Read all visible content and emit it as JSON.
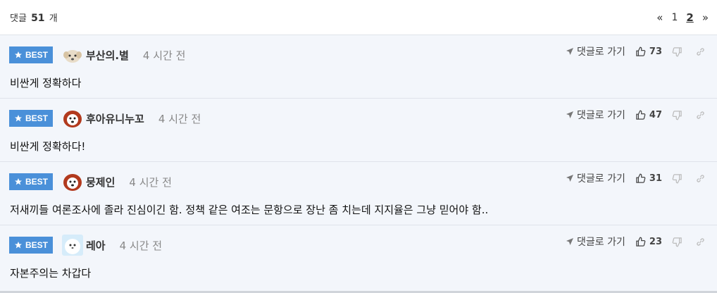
{
  "header": {
    "count_prefix": "댓글",
    "count": "51",
    "count_suffix": "개",
    "pager": {
      "first": "«",
      "page1": "1",
      "page2": "2",
      "last": "»"
    }
  },
  "comments": [
    {
      "badge": "BEST",
      "nick": "부산의.별",
      "time": "4 시간 전",
      "goto": "댓글로 가기",
      "likes": "73",
      "text": "비싼게 정확하다"
    },
    {
      "badge": "BEST",
      "nick": "후아유니누꼬",
      "time": "4 시간 전",
      "goto": "댓글로 가기",
      "likes": "47",
      "text": "비싼게 정확하다!"
    },
    {
      "badge": "BEST",
      "nick": "뭉제인",
      "time": "4 시간 전",
      "goto": "댓글로 가기",
      "likes": "31",
      "text": "저새끼들 여론조사에 졸라 진심이긴 함. 정책 같은 여조는 문항으로 장난 좀 치는데 지지율은 그냥 믿어야 함.."
    },
    {
      "badge": "BEST",
      "nick": "레아",
      "time": "4 시간 전",
      "goto": "댓글로 가기",
      "likes": "23",
      "text": "자본주의는 차갑다"
    }
  ],
  "colors": {
    "badge": "#4a90d9",
    "background": "#f3f6fb"
  },
  "icons": [
    "star-icon",
    "send-icon",
    "thumbs-up-icon",
    "thumbs-down-icon",
    "link-icon"
  ]
}
